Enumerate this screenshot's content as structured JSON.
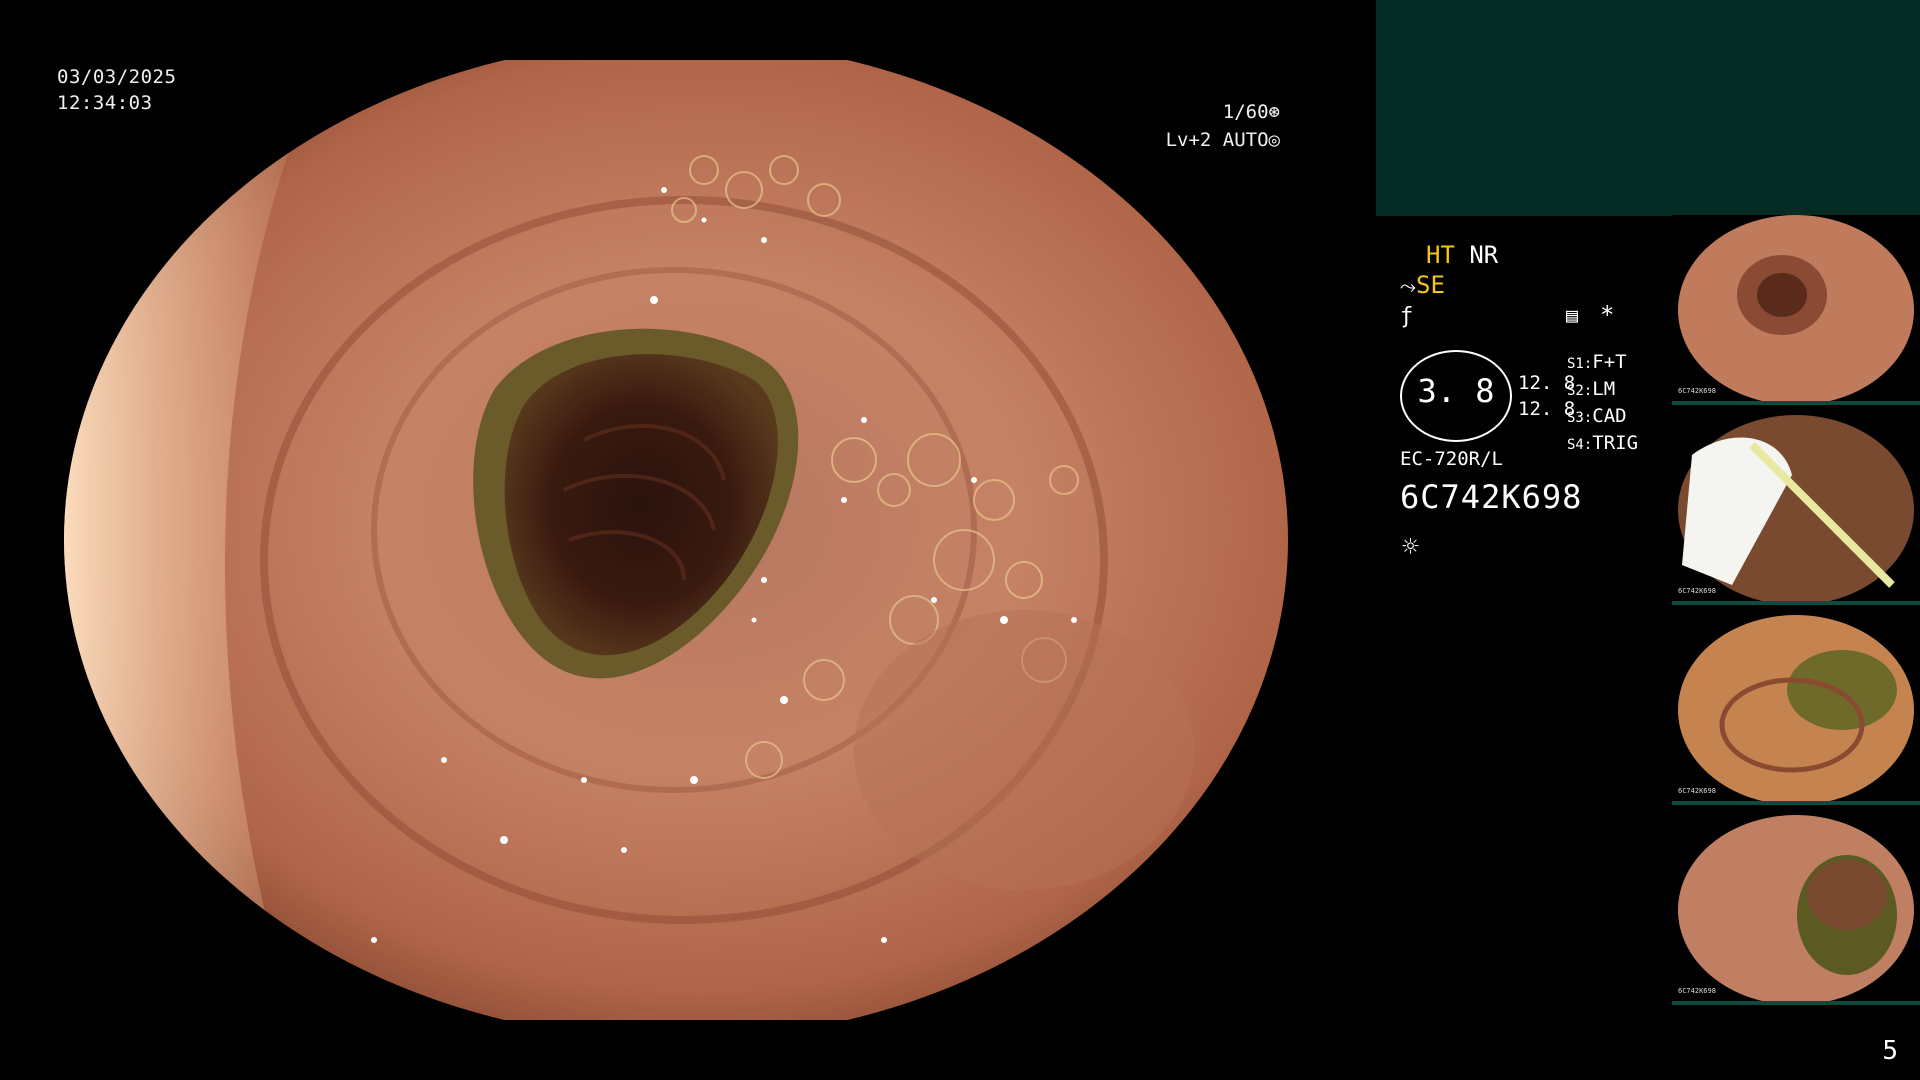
{
  "overlay": {
    "date": "03/03/2025",
    "time": "12:34:03",
    "shutter": "1/60",
    "level": "Lv+2",
    "exposure_mode": "AUTO",
    "shutter_icon": "aperture-icon",
    "exposure_icon": "target-icon"
  },
  "settings": {
    "ht": "HT",
    "nr": "NR",
    "se": "SE",
    "se_icon": "enhance-icon",
    "fx_icon": "f-slash-icon",
    "menu_icon": "menu-icon",
    "star": "*",
    "gauge_value": "3. 8",
    "side_values": [
      "12. 8",
      "12. 8"
    ],
    "presets": [
      {
        "key": "S1:",
        "value": "F+T"
      },
      {
        "key": "S2:",
        "value": "LM"
      },
      {
        "key": "S3:",
        "value": "CAD"
      },
      {
        "key": "S4:",
        "value": "TRIG"
      }
    ],
    "model": "EC-720R/L",
    "serial": "6C742K698",
    "light_icon": "light-sun-icon"
  },
  "thumbnails": [
    {
      "label": "6C742K698"
    },
    {
      "label": "6C742K698"
    },
    {
      "label": "6C742K698"
    },
    {
      "label": "6C742K698"
    }
  ],
  "page_number": "5",
  "colors": {
    "accent_yellow": "#f5c518",
    "panel_green": "#032a23",
    "thumb_border": "#0e4b3f"
  }
}
